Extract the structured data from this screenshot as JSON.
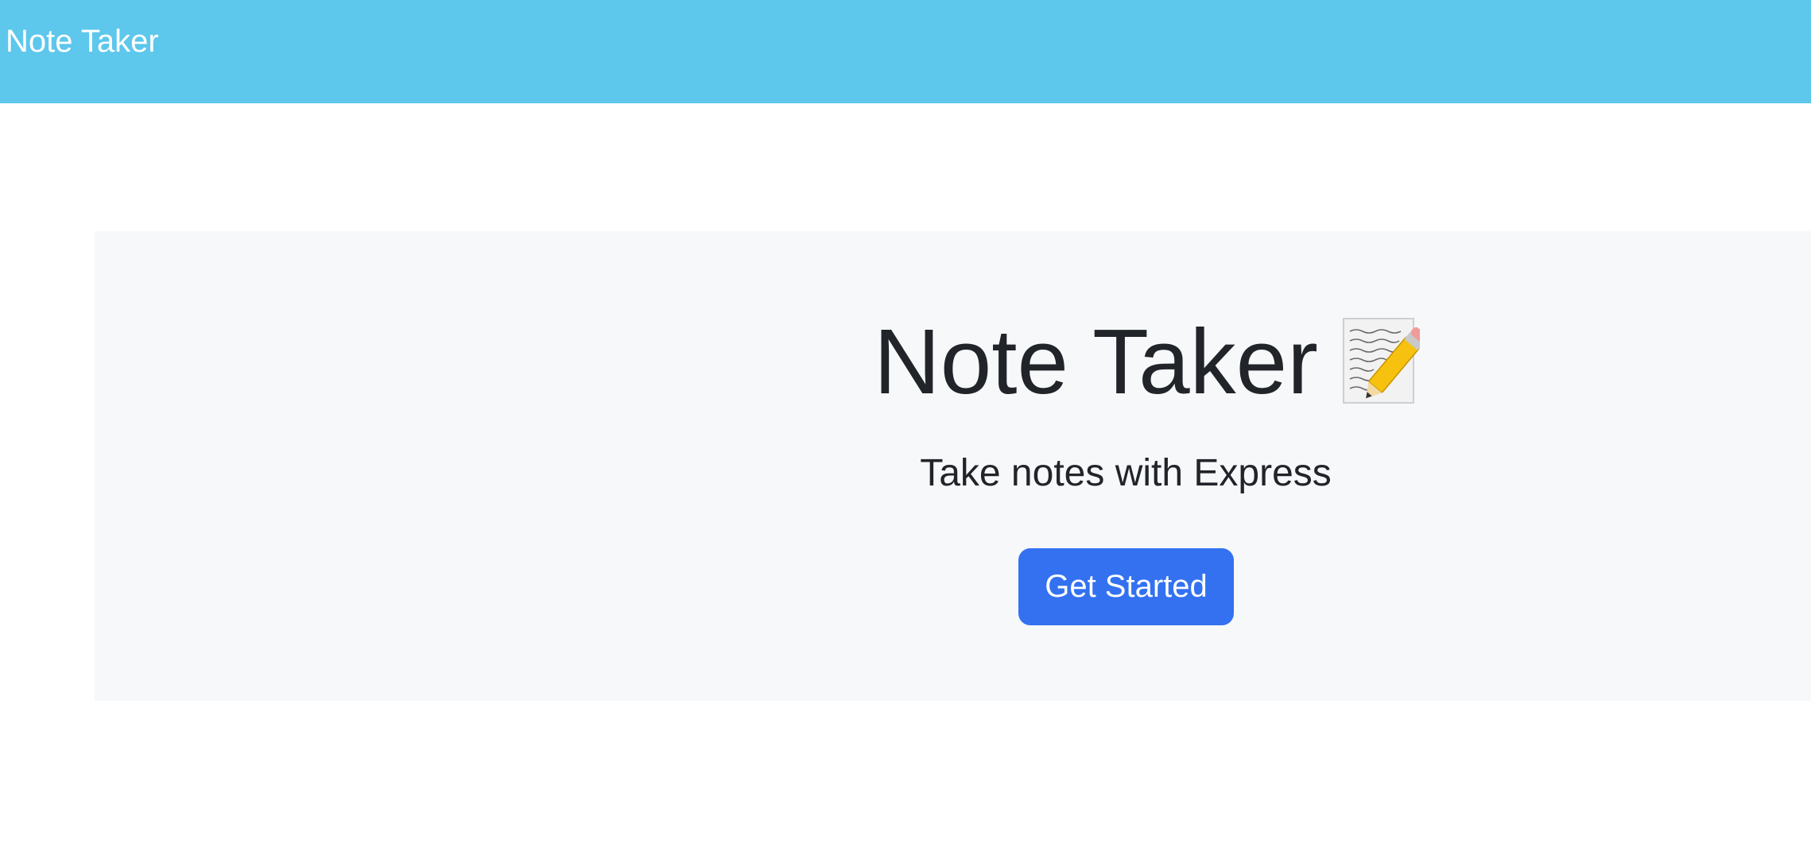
{
  "navbar": {
    "brand": "Note Taker",
    "background_color": "#5dc7ec"
  },
  "hero": {
    "title": "Note Taker",
    "title_icon": "memo-pencil-icon",
    "subtitle": "Take notes with Express",
    "button_label": "Get Started",
    "button_color": "#3371f0",
    "background_color": "#f7f8fa"
  }
}
